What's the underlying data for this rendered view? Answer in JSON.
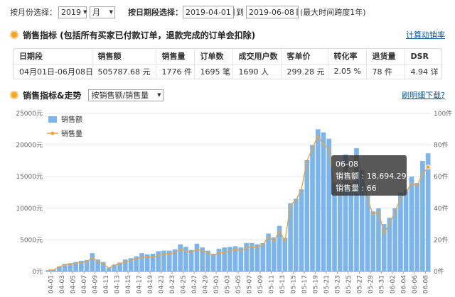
{
  "filters": {
    "month_label": "按月份选择：",
    "year": "2019",
    "month": "月",
    "date_label": "按日期段选择：",
    "start_date": "2019-04-01",
    "to_label": "到",
    "end_date": "2019-06-08",
    "hint": "(最大时间跨度1年)"
  },
  "sales_section": {
    "title": "销售指标 (包括所有买家已付款订单，退款完成的订单会扣除)",
    "link": "计算动销率"
  },
  "metrics": {
    "headers": [
      "日期段",
      "销售额",
      "销售量",
      "订单数",
      "成交用户数",
      "客单价",
      "转化率",
      "退货量",
      "DSR"
    ],
    "values": [
      "04月01日-06月08日",
      "505787.68 元",
      "1776 件",
      "1695 笔",
      "1690 人",
      "299.28 元",
      "2.05 %",
      "78 件",
      "4.94 详"
    ]
  },
  "trend_section": {
    "title": "销售指标&走势",
    "select": "按销售额/销售量",
    "link": "刷明细下载?"
  },
  "colors": {
    "bar": "#7cb5ec",
    "line": "#f0a23b",
    "accent": "#f5a623",
    "link": "#0b5ba8"
  },
  "chart_data": {
    "type": "bar",
    "legend": [
      "销售额",
      "销售量"
    ],
    "legend_position": "top-left",
    "y_left": {
      "ticks": [
        "0元",
        "5000元",
        "10000元",
        "15000元",
        "20000元",
        "25000元"
      ],
      "range": [
        0,
        25000
      ]
    },
    "y_right": {
      "ticks": [
        "0件",
        "20件",
        "40件",
        "60件",
        "80件",
        "100件"
      ],
      "range": [
        0,
        100
      ]
    },
    "grid": true,
    "x_ticks": [
      "04-01",
      "04-03",
      "04-05",
      "04-07",
      "04-09",
      "04-11",
      "04-13",
      "04-15",
      "04-17",
      "04-19",
      "04-21",
      "04-23",
      "04-25",
      "04-27",
      "04-29",
      "05-01",
      "05-03",
      "05-05",
      "05-07",
      "05-09",
      "05-11",
      "05-13",
      "05-15",
      "05-17",
      "05-19",
      "05-21",
      "05-23",
      "05-25",
      "05-27",
      "05-29",
      "05-31",
      "06-02",
      "06-04",
      "06-06",
      "06-08"
    ],
    "series": [
      {
        "name": "销售额",
        "axis": "left",
        "values": [
          200,
          300,
          800,
          1200,
          1300,
          1500,
          1700,
          1800,
          2900,
          1900,
          1500,
          600,
          1100,
          1400,
          1900,
          2100,
          2400,
          2900,
          2700,
          2800,
          3200,
          3300,
          3300,
          3500,
          4300,
          3900,
          3400,
          4400,
          3800,
          3300,
          2800,
          3600,
          3800,
          3900,
          4000,
          3800,
          4500,
          4500,
          4300,
          4500,
          6000,
          5400,
          7200,
          5300,
          10800,
          11500,
          13000,
          17600,
          20000,
          22500,
          22000,
          21000,
          14000,
          13500,
          18500,
          14000,
          19500,
          16000,
          12000,
          9500,
          10000,
          7500,
          8500,
          10000,
          12500,
          13000,
          15000,
          14000,
          17500,
          18694.29
        ]
      },
      {
        "name": "销售量",
        "axis": "right",
        "values": [
          1,
          1,
          3,
          4,
          5,
          5,
          6,
          6,
          9,
          6,
          5,
          2,
          4,
          5,
          6,
          7,
          8,
          9,
          9,
          9,
          10,
          11,
          11,
          12,
          14,
          13,
          12,
          14,
          13,
          12,
          10,
          12,
          12,
          13,
          14,
          13,
          15,
          16,
          15,
          17,
          22,
          19,
          26,
          19,
          42,
          45,
          52,
          70,
          78,
          86,
          80,
          78,
          50,
          48,
          68,
          52,
          74,
          62,
          46,
          36,
          38,
          24,
          30,
          38,
          46,
          50,
          56,
          54,
          62,
          66
        ]
      }
    ],
    "tooltip": {
      "date": "06-08",
      "line1": "销售额 : 18,694.29",
      "line2": "销售量 : 66"
    }
  }
}
